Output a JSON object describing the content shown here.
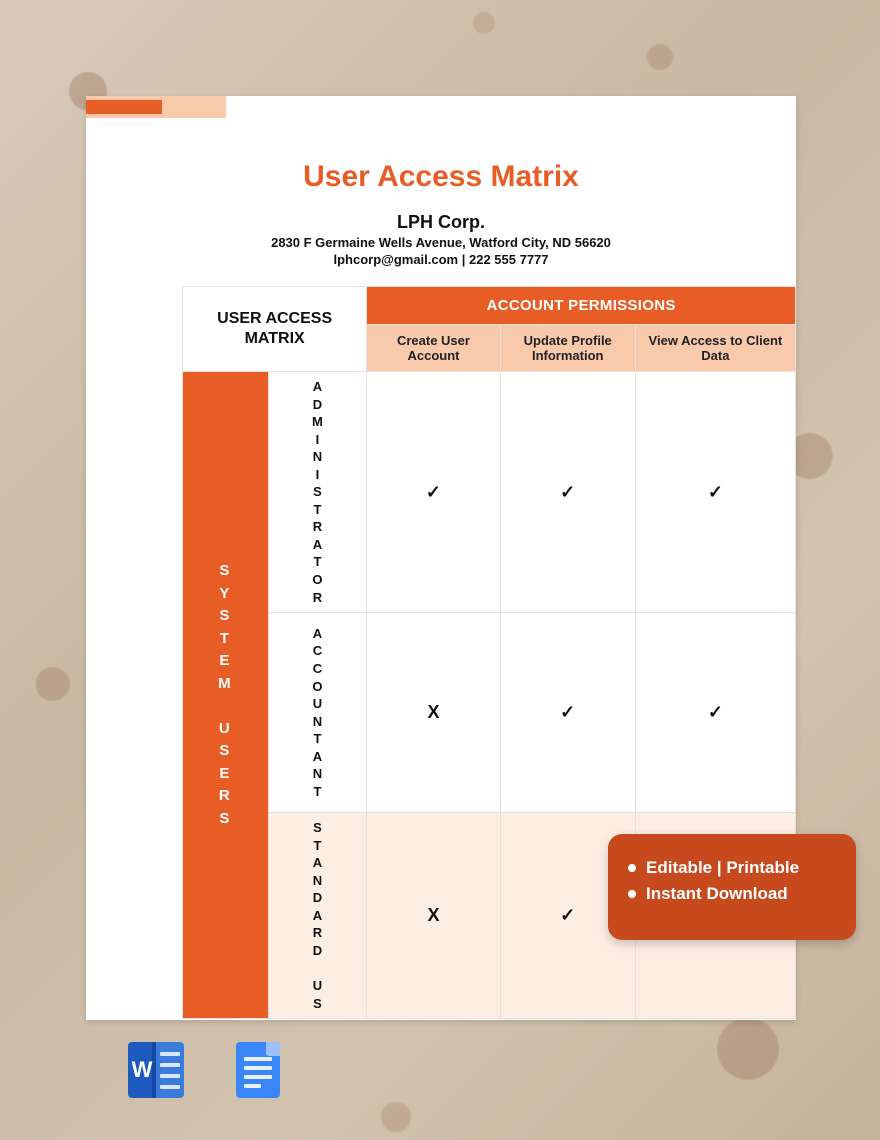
{
  "document": {
    "title": "User Access Matrix",
    "company": {
      "name": "LPH Corp.",
      "address": "2830 F Germaine Wells Avenue, Watford City, ND 56620",
      "contact": "lphcorp@gmail.com | 222 555 7777"
    }
  },
  "matrix": {
    "corner_label_line1": "USER ACCESS",
    "corner_label_line2": "MATRIX",
    "permissions_header": "ACCOUNT PERMISSIONS",
    "permissions": [
      "Create User Account",
      "Update Profile Information",
      "View Access to Client Data"
    ],
    "system_users_label": "SYSTEM USERS",
    "roles": [
      {
        "name": "ADMINISTRATOR",
        "values": [
          "✓",
          "✓",
          "✓"
        ]
      },
      {
        "name": "ACCOUNTANT",
        "values": [
          "X",
          "✓",
          "✓"
        ]
      },
      {
        "name": "STANDARD US",
        "values": [
          "X",
          "✓",
          ""
        ]
      }
    ]
  },
  "badge": {
    "line1": "Editable | Printable",
    "line2": "Instant Download"
  },
  "icons": {
    "word": "Microsoft Word",
    "gdocs": "Google Docs"
  }
}
